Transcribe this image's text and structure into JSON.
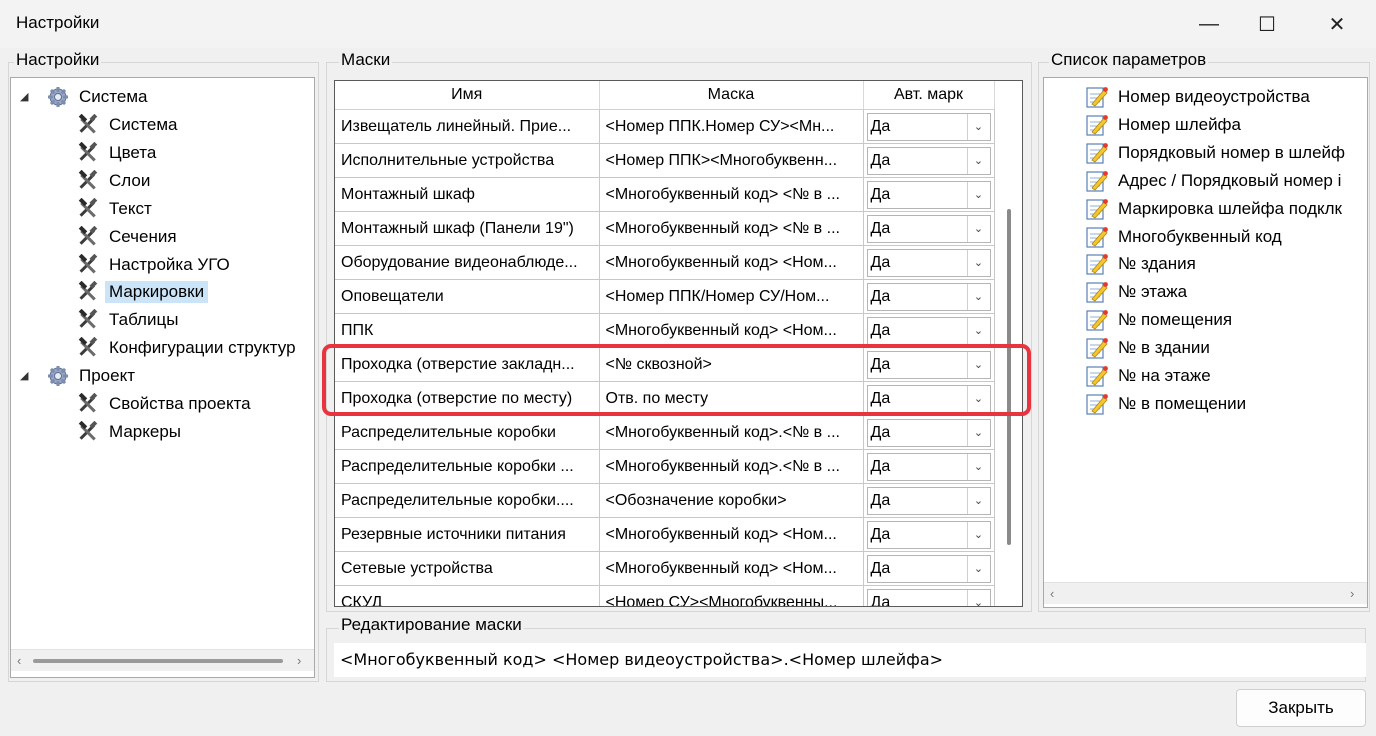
{
  "window": {
    "title": "Настройки",
    "minimize": "—",
    "maximize": "☐",
    "close": "✕"
  },
  "groups": {
    "settings": "Настройки",
    "masks": "Маски",
    "params": "Список параметров",
    "edit": "Редактирование маски"
  },
  "tree": [
    {
      "label": "Система",
      "icon": "gear-icon",
      "expanded": true
    },
    {
      "label": "Система",
      "icon": "tools-icon"
    },
    {
      "label": "Цвета",
      "icon": "tools-icon"
    },
    {
      "label": "Слои",
      "icon": "tools-icon"
    },
    {
      "label": "Текст",
      "icon": "tools-icon"
    },
    {
      "label": "Сечения",
      "icon": "tools-icon"
    },
    {
      "label": "Настройка УГО",
      "icon": "tools-icon"
    },
    {
      "label": "Маркировки",
      "icon": "tools-icon",
      "selected": true
    },
    {
      "label": "Таблицы",
      "icon": "tools-icon"
    },
    {
      "label": "Конфигурации структур",
      "icon": "tools-icon"
    },
    {
      "label": "Проект",
      "icon": "gear-icon",
      "expanded": true
    },
    {
      "label": "Свойства проекта",
      "icon": "tools-icon"
    },
    {
      "label": "Маркеры",
      "icon": "tools-icon"
    }
  ],
  "table": {
    "headers": [
      "Имя",
      "Маска",
      "Авт. марк"
    ],
    "rows": [
      {
        "name": "Извещатель линейный. Прие...",
        "mask": "<Номер ППК.Номер СУ><Мн...",
        "auto": "Да"
      },
      {
        "name": "Исполнительные устройства",
        "mask": "<Номер ППК><Многобуквенн...",
        "auto": "Да"
      },
      {
        "name": "Монтажный шкаф",
        "mask": "<Многобуквенный код> <№ в ...",
        "auto": "Да"
      },
      {
        "name": "Монтажный шкаф (Панели 19\")",
        "mask": "<Многобуквенный код> <№ в ...",
        "auto": "Да"
      },
      {
        "name": "Оборудование видеонаблюде...",
        "mask": "<Многобуквенный код> <Ном...",
        "auto": "Да"
      },
      {
        "name": "Оповещатели",
        "mask": "<Номер ППК/Номер СУ/Ном...",
        "auto": "Да"
      },
      {
        "name": "ППК",
        "mask": "<Многобуквенный код> <Ном...",
        "auto": "Да"
      },
      {
        "name": "Проходка (отверстие закладн...",
        "mask": "<№ сквозной>",
        "auto": "Да"
      },
      {
        "name": "Проходка (отверстие по месту)",
        "mask": "Отв. по месту",
        "auto": "Да"
      },
      {
        "name": "Распределительные коробки",
        "mask": "<Многобуквенный код>.<№ в ...",
        "auto": "Да"
      },
      {
        "name": "Распределительные коробки ...",
        "mask": "<Многобуквенный код>.<№ в ...",
        "auto": "Да"
      },
      {
        "name": "Распределительные коробки....",
        "mask": "<Обозначение коробки>",
        "auto": "Да"
      },
      {
        "name": "Резервные источники питания",
        "mask": "<Многобуквенный код> <Ном...",
        "auto": "Да"
      },
      {
        "name": "Сетевые устройства",
        "mask": "<Многобуквенный код> <Ном...",
        "auto": "Да"
      },
      {
        "name": "СКУД",
        "mask": "<Номер СУ><Многобуквенны...",
        "auto": "Да"
      }
    ]
  },
  "params": [
    "Номер видеоустройства",
    "Номер шлейфа",
    "Порядковый номер в шлейф",
    "Адрес / Порядковый номер і",
    "Маркировка шлейфа подклк",
    "Многобуквенный код",
    "№ здания",
    "№ этажа",
    "№ помещения",
    "№ в здании",
    "№ на этаже",
    "№ в помещении"
  ],
  "edit_mask_value": "<Многобуквенный код> <Номер видеоустройства>.<Номер шлейфа>",
  "close_button": "Закрыть",
  "colors": {
    "highlight": "#e8343f",
    "selection": "#cce4f7"
  }
}
